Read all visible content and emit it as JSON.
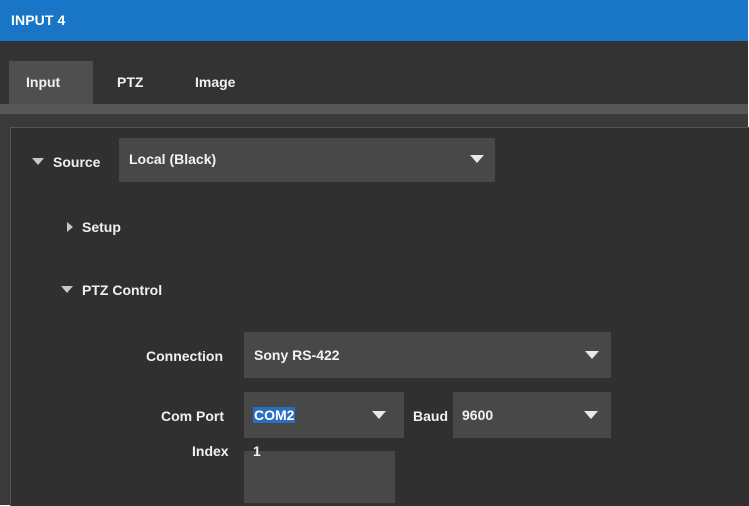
{
  "window": {
    "title": "INPUT 4"
  },
  "tabs": [
    {
      "label": "Input",
      "active": true
    },
    {
      "label": "PTZ",
      "active": false
    },
    {
      "label": "Image",
      "active": false
    }
  ],
  "source": {
    "label": "Source",
    "value": "Local (Black)"
  },
  "sections": {
    "setup": {
      "label": "Setup",
      "expanded": false
    },
    "ptz_control": {
      "label": "PTZ Control",
      "expanded": true
    }
  },
  "ptz": {
    "connection": {
      "label": "Connection",
      "value": "Sony RS-422"
    },
    "com_port": {
      "label": "Com Port",
      "value": "COM2"
    },
    "baud": {
      "label": "Baud",
      "value": "9600"
    },
    "index": {
      "label": "Index",
      "value": "1"
    }
  },
  "colors": {
    "titlebar": "#1976c6",
    "selection": "#2a6fbf",
    "panel": "#303030",
    "field": "#484848"
  }
}
